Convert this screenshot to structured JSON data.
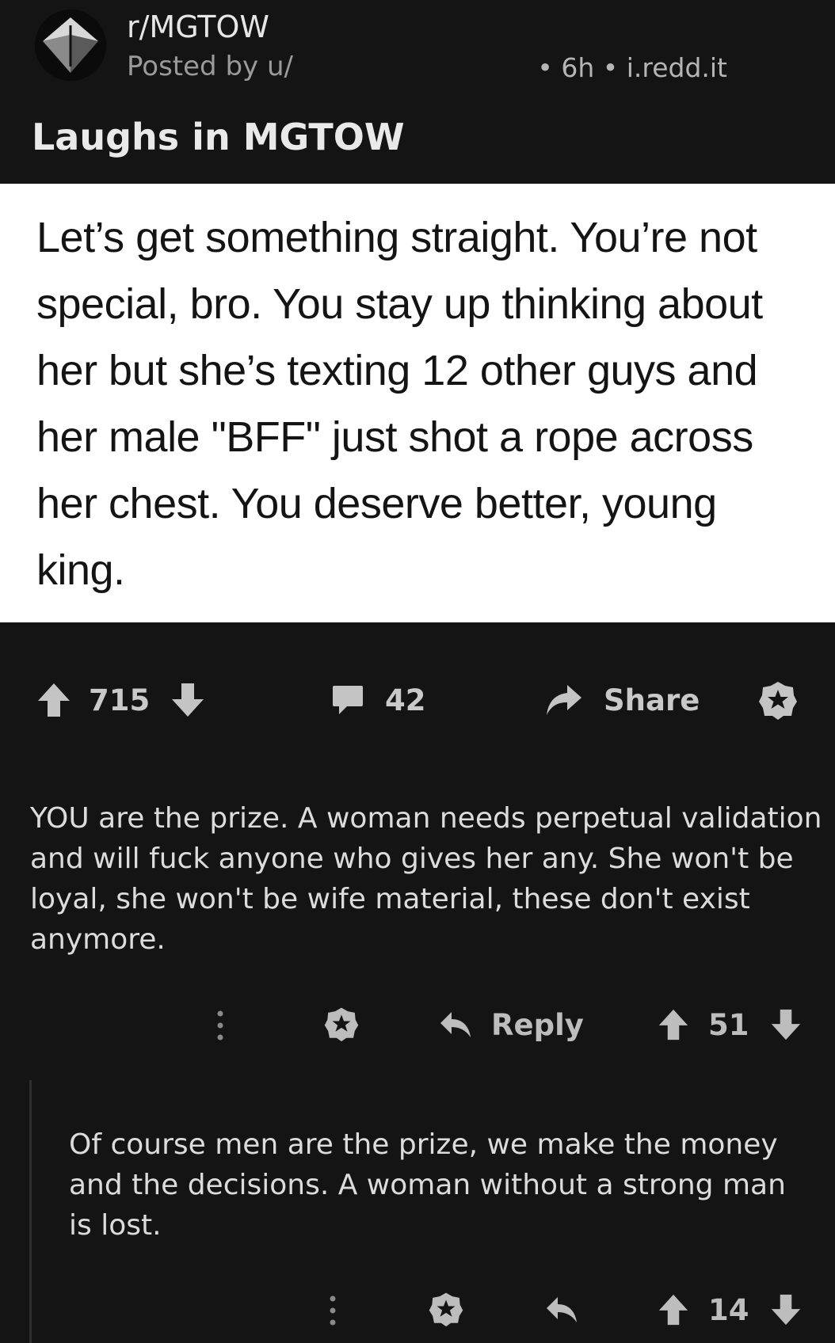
{
  "header": {
    "subreddit": "r/MGTOW",
    "posted_by": "Posted by u/",
    "meta": "• 6h • i.redd.it",
    "title": "Laughs in MGTOW"
  },
  "post_image": {
    "text": "Let’s get something straight. You’re not special, bro. You stay up thinking about her but she’s texting 12 other guys and her male \"BFF\" just shot a rope across her chest. You deserve better, young king."
  },
  "post_actions": {
    "vote_count": "715",
    "comment_count": "42",
    "share_label": "Share"
  },
  "comments": [
    {
      "text": "YOU are the prize.  A woman needs perpetual validation and will fuck anyone who gives her any. She won't be loyal, she won't be wife material, these don't exist anymore.",
      "reply_label": "Reply",
      "score": "51"
    },
    {
      "text": "Of course men are the prize, we make the money and the decisions.  A woman without a strong man is lost.",
      "score": "14"
    }
  ],
  "colors": {
    "background": "#141414",
    "image_background": "#ffffff",
    "icon": "#c4c4c4"
  }
}
